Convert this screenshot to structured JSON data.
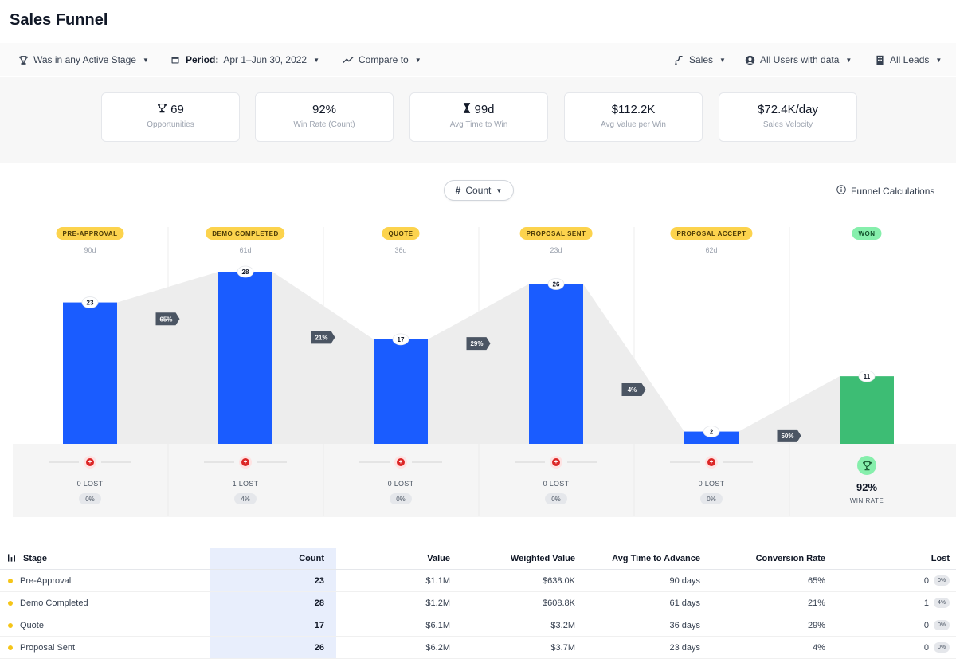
{
  "header": {
    "title": "Sales Funnel"
  },
  "filters": {
    "stage_filter": "Was in any Active Stage",
    "period_label": "Period:",
    "period_value": "Apr 1–Jun 30, 2022",
    "compare": "Compare to",
    "pipeline": "Sales",
    "users": "All Users with data",
    "leads": "All Leads"
  },
  "kpis": [
    {
      "value": "69",
      "label": "Opportunities",
      "icon": "trophy-icon"
    },
    {
      "value": "92%",
      "label": "Win Rate (Count)"
    },
    {
      "value": "99d",
      "label": "Avg Time to Win",
      "icon": "hourglass-icon"
    },
    {
      "value": "$112.2K",
      "label": "Avg Value per Win"
    },
    {
      "value": "$72.4K/day",
      "label": "Sales Velocity"
    }
  ],
  "controls": {
    "metric": "Count",
    "calc_link": "Funnel Calculations"
  },
  "colors": {
    "bar": "#1a5cff",
    "won_bar": "#3dbd74",
    "badge": "#fcd34d",
    "won_badge": "#86efac"
  },
  "chart_data": {
    "type": "bar",
    "categories": [
      "PRE-APPROVAL",
      "DEMO COMPLETED",
      "QUOTE",
      "PROPOSAL SENT",
      "PROPOSAL ACCEPT",
      "WON"
    ],
    "values": [
      23,
      28,
      17,
      26,
      2,
      11
    ],
    "days": [
      "90d",
      "61d",
      "36d",
      "23d",
      "62d",
      ""
    ],
    "conversion": [
      "65%",
      "21%",
      "29%",
      "4%",
      "50%"
    ],
    "lost": [
      "0 LOST",
      "1 LOST",
      "0 LOST",
      "0 LOST",
      "0 LOST"
    ],
    "lost_pct": [
      "0%",
      "4%",
      "0%",
      "0%",
      "0%"
    ],
    "ylim": [
      0,
      28
    ]
  },
  "win": {
    "value": "92%",
    "label": "WIN RATE"
  },
  "table": {
    "headers": [
      "Stage",
      "Count",
      "Value",
      "Weighted Value",
      "Avg Time to Advance",
      "Conversion Rate",
      "Lost"
    ],
    "rows": [
      {
        "stage": "Pre-Approval",
        "count": "23",
        "value": "$1.1M",
        "weighted": "$638.0K",
        "time": "90 days",
        "conv": "65%",
        "lost": "0",
        "lost_pct": "0%"
      },
      {
        "stage": "Demo Completed",
        "count": "28",
        "value": "$1.2M",
        "weighted": "$608.8K",
        "time": "61 days",
        "conv": "21%",
        "lost": "1",
        "lost_pct": "4%"
      },
      {
        "stage": "Quote",
        "count": "17",
        "value": "$6.1M",
        "weighted": "$3.2M",
        "time": "36 days",
        "conv": "29%",
        "lost": "0",
        "lost_pct": "0%"
      },
      {
        "stage": "Proposal Sent",
        "count": "26",
        "value": "$6.2M",
        "weighted": "$3.7M",
        "time": "23 days",
        "conv": "4%",
        "lost": "0",
        "lost_pct": "0%"
      }
    ]
  }
}
